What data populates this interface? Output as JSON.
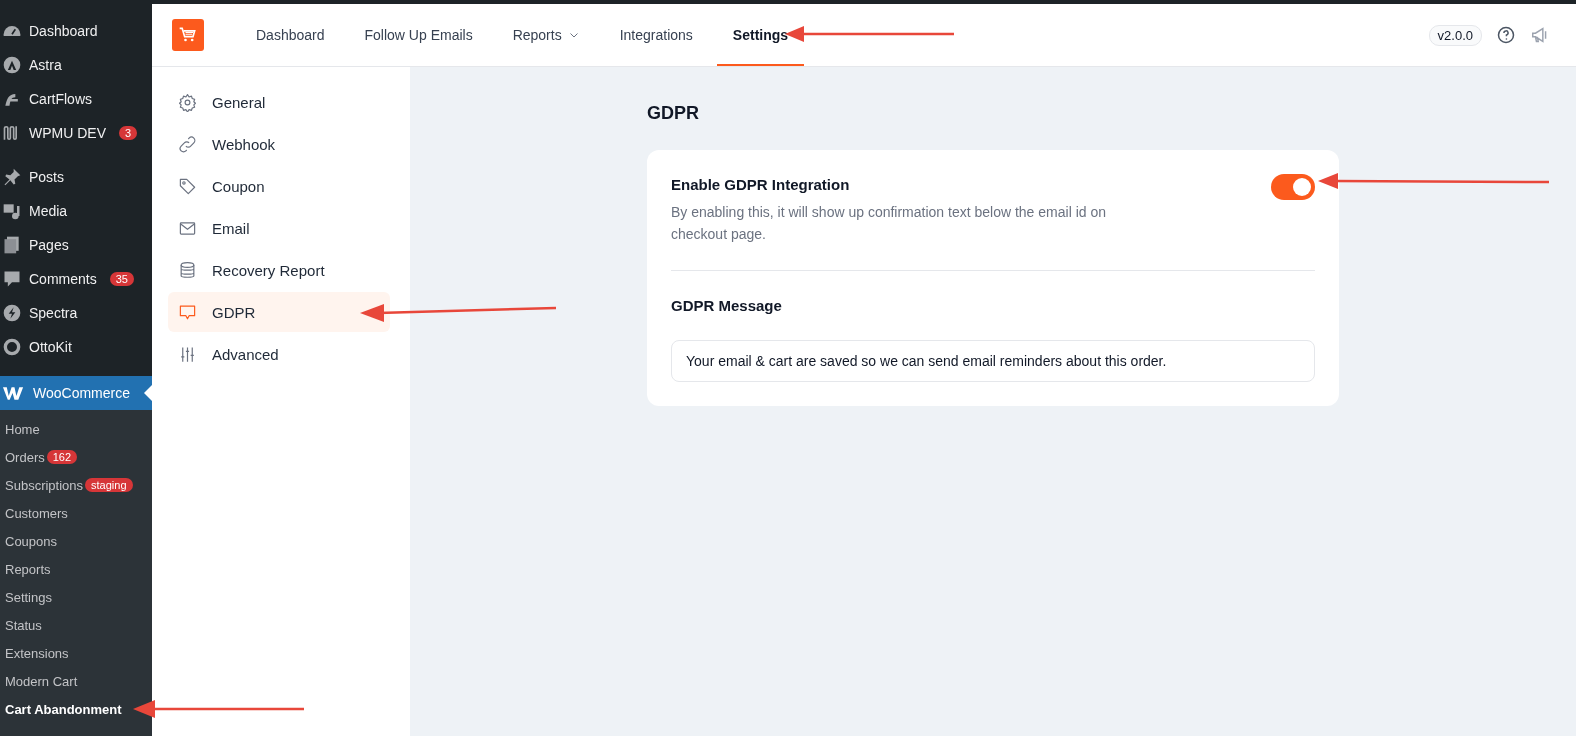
{
  "admin_menu": {
    "items": [
      {
        "label": "Dashboard"
      },
      {
        "label": "Astra"
      },
      {
        "label": "CartFlows"
      },
      {
        "label": "WPMU DEV",
        "badge": "3"
      },
      {
        "label": "Posts"
      },
      {
        "label": "Media"
      },
      {
        "label": "Pages"
      },
      {
        "label": "Comments",
        "badge": "35"
      },
      {
        "label": "Spectra"
      },
      {
        "label": "OttoKit"
      }
    ],
    "current": {
      "label": "WooCommerce"
    },
    "submenu": [
      {
        "label": "Home",
        "selected": false
      },
      {
        "label": "Orders",
        "badge": "162",
        "selected": false
      },
      {
        "label": "Subscriptions",
        "badge": "staging",
        "selected": false
      },
      {
        "label": "Customers",
        "selected": false
      },
      {
        "label": "Coupons",
        "selected": false
      },
      {
        "label": "Reports",
        "selected": false
      },
      {
        "label": "Settings",
        "selected": false
      },
      {
        "label": "Status",
        "selected": false
      },
      {
        "label": "Extensions",
        "selected": false
      },
      {
        "label": "Modern Cart",
        "selected": false
      },
      {
        "label": "Cart Abandonment",
        "selected": true
      }
    ]
  },
  "header": {
    "tabs": [
      {
        "label": "Dashboard",
        "kind": "link",
        "selected": false
      },
      {
        "label": "Follow Up Emails",
        "kind": "link",
        "selected": false
      },
      {
        "label": "Reports",
        "kind": "dropdown",
        "selected": false
      },
      {
        "label": "Integrations",
        "kind": "link",
        "selected": false
      },
      {
        "label": "Settings",
        "kind": "link",
        "selected": true
      }
    ],
    "version": "v2.0.0"
  },
  "settings_nav": [
    {
      "label": "General",
      "selected": false
    },
    {
      "label": "Webhook",
      "selected": false
    },
    {
      "label": "Coupon",
      "selected": false
    },
    {
      "label": "Email",
      "selected": false
    },
    {
      "label": "Recovery Report",
      "selected": false
    },
    {
      "label": "GDPR",
      "selected": true
    },
    {
      "label": "Advanced",
      "selected": false
    }
  ],
  "gdpr": {
    "title": "GDPR",
    "toggle": {
      "label": "Enable GDPR Integration",
      "description": "By enabling this, it will show up confirmation text below the email id on checkout page.",
      "on": true
    },
    "message": {
      "label": "GDPR Message",
      "value": "Your email & cart are saved so we can send email reminders about this order."
    }
  }
}
